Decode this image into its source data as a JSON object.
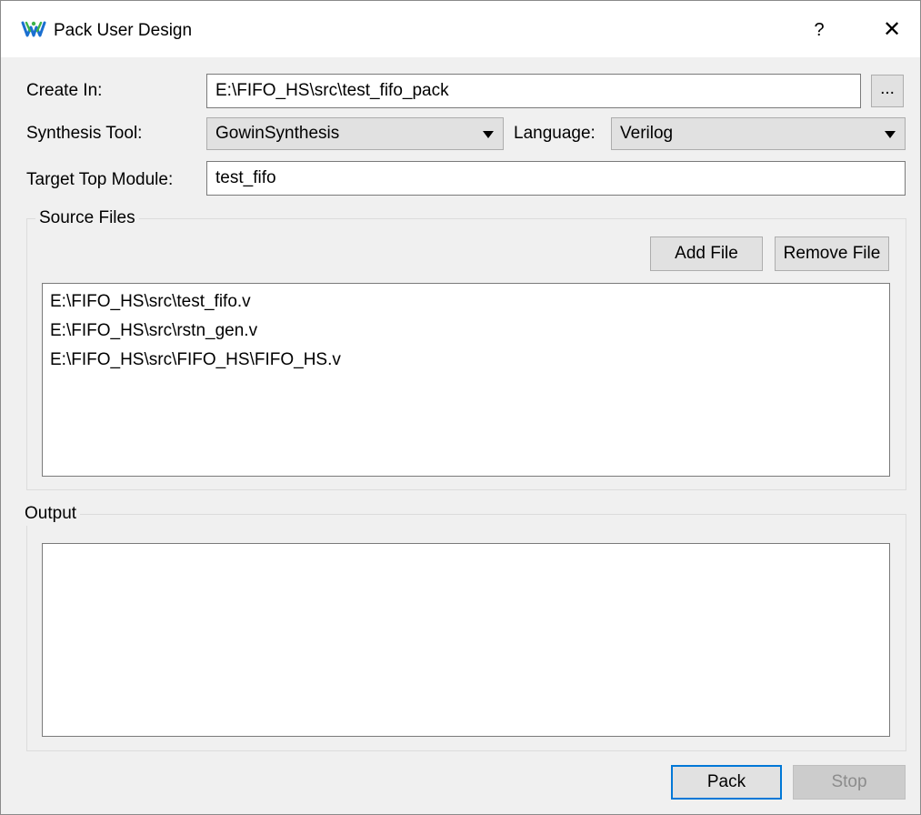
{
  "window": {
    "title": "Pack User Design",
    "help_label": "?",
    "close_label": "✕"
  },
  "form": {
    "create_in_label": "Create In:",
    "create_in_value": "E:\\FIFO_HS\\src\\test_fifo_pack",
    "browse_label": "...",
    "synthesis_tool_label": "Synthesis Tool:",
    "synthesis_tool_value": "GowinSynthesis",
    "language_label": "Language:",
    "language_value": "Verilog",
    "target_top_module_label": "Target Top Module:",
    "target_top_module_value": "test_fifo"
  },
  "source_files": {
    "title": "Source Files",
    "add_label": "Add File",
    "remove_label": "Remove File",
    "files": [
      "E:\\FIFO_HS\\src\\test_fifo.v",
      "E:\\FIFO_HS\\src\\rstn_gen.v",
      "E:\\FIFO_HS\\src\\FIFO_HS\\FIFO_HS.v"
    ]
  },
  "output": {
    "title": "Output"
  },
  "actions": {
    "pack_label": "Pack",
    "stop_label": "Stop"
  },
  "icons": {
    "app": "gowin-logo-icon",
    "close": "close-icon",
    "dropdown": "chevron-down-icon"
  },
  "colors": {
    "window_bg": "#f0f0f0",
    "titlebar_bg": "#ffffff",
    "default_button_border": "#0078d7",
    "logo_blue": "#1a6fd0",
    "logo_green": "#3cb44a"
  }
}
